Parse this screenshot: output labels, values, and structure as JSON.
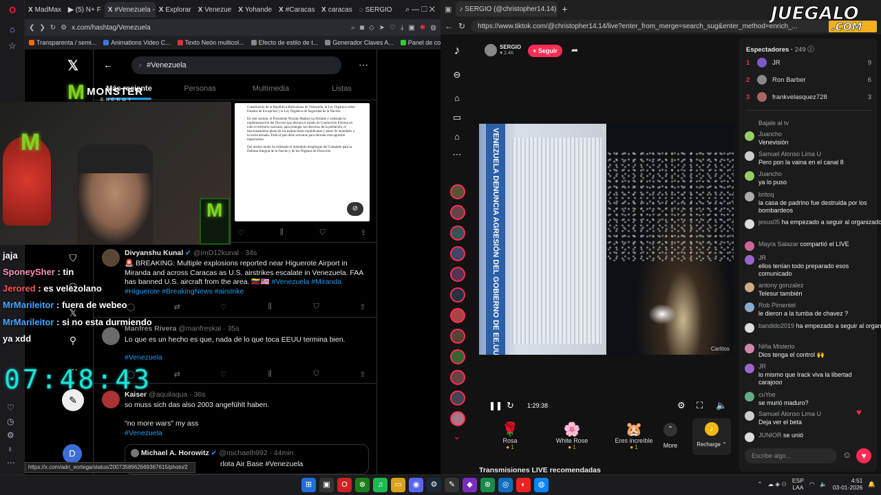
{
  "left_browser": {
    "tabs": [
      {
        "label": "MadMax",
        "fav": "X"
      },
      {
        "label": "(5) N+ F",
        "fav": "▶"
      },
      {
        "label": "#Venezuela - Bú",
        "fav": "X"
      },
      {
        "label": "Explorar",
        "fav": "X"
      },
      {
        "label": "Venezue",
        "fav": "X"
      },
      {
        "label": "Yohande",
        "fav": "X"
      },
      {
        "label": "#Caracas",
        "fav": "X"
      },
      {
        "label": "caracas",
        "fav": "X"
      },
      {
        "label": "SERGIO",
        "fav": "◌"
      }
    ],
    "url": "x.com/hashtag/Venezuela",
    "bookmarks": [
      {
        "label": "Transparenta / semi...",
        "color": "#ff6a00"
      },
      {
        "label": "Animations Video C...",
        "color": "#3a7bd5"
      },
      {
        "label": "Texto Neón multicol...",
        "color": "#d33"
      },
      {
        "label": "Efecto de estilo de t...",
        "color": "#888"
      },
      {
        "label": "Generador Claves A...",
        "color": "#888"
      },
      {
        "label": "Panel de control del...",
        "color": "#3c3"
      }
    ],
    "status_url": "https://x.com/adri_eortega/status/2007358962669367615/photo/2"
  },
  "x": {
    "search_value": "#Venezuela",
    "tabs": [
      "Más reciente",
      "Personas",
      "Multimedia",
      "Listas"
    ],
    "active_tab": "Más reciente",
    "avatar_letter": "D",
    "doc_paragraphs": [
      "Constitución de la República Bolivariana de Venezuela, la Ley Orgánica sobre Estados de Excepción y la Ley Orgánica de Seguridad de la Nación.",
      "En este sentido, el Presidente Nicolás Maduro ha firmado y ordenado la implementación del Decreto que declara el estado de Conmoción Externa en todo el territorio nacional, para proteger los derechos de la población, el funcionamiento pleno de las instituciones republicanas y pasar de inmediato a la lucha armada. Todo el país debe activarse para derrotar esta agresión imperialista.",
      "Del mismo modo ha ordenado el inmediato despliegue del Comando para la Defensa Integral de la Nación y de los Órganos de Dirección"
    ],
    "tweets": [
      {
        "name": "Divyanshu Kunal",
        "handle": "@imD12kunal",
        "time": "34s",
        "text_plain": "🚨 BREAKING: Multiple explosions reported near Higuerote Airport in Miranda and across Caracas as U.S. airstrikes escalate in Venezuela. FAA has banned U.S. aircraft from the area. 🇻🇪🇺🇸 ",
        "hashtags": "#Venezuela #Miranda #Higuerote #BreakingNews #airstrike"
      },
      {
        "name": "Manfres Rivera",
        "handle": "@manfreskal",
        "time": "35s",
        "text_plain": "Lo que es un hecho es que, nada de lo que toca EEUU termina bien.",
        "hashtags": "#Venezuela"
      },
      {
        "name": "Kaiser",
        "handle": "@aquilaqua",
        "time": "36s",
        "text_plain": "so muss sich das also 2003 angefühlt haben.",
        "text_2": "\"no more wars\" my ass",
        "hashtags": "#Venezuela"
      }
    ],
    "quoted": {
      "name": "Michael A. Horowitz",
      "handle": "@michaelh992",
      "time": "44min",
      "text": "rlota Air Base #Venezuela"
    }
  },
  "stream_overlay": {
    "brand": "MONSTER",
    "brand_sub": "ENERGY",
    "chat": [
      {
        "user": "",
        "text": "jaja",
        "color": "#ffffff"
      },
      {
        "user": "SponeySher",
        "text": " : tin",
        "color": "#ff8fb1"
      },
      {
        "user": "Jerored",
        "text": " : es velezolano",
        "color": "#ff5252"
      },
      {
        "user": "MrMarileitor",
        "text": " : fuera de webeo",
        "color": "#4aa3ff"
      },
      {
        "user": "MrMarileitor",
        "text": " : si no esta durmiendo",
        "color": "#4aa3ff"
      },
      {
        "user": "",
        "text": "ya xdd",
        "color": "#ffffff"
      }
    ],
    "clock": "07:48:43"
  },
  "right_browser": {
    "tab_label": "SERGIO (@christopher14.14)",
    "url": "https://www.tiktok.com/@christopher14.14/live?enter_from_merge=search_sug&enter_method=enrich_...",
    "brand": "JUEGALO",
    "brand_sub": ".COM",
    "streamer_name": "SERGIO",
    "streamer_likes": "2.4K",
    "follow_label": "+ Seguir",
    "video_caption": "Carlitos",
    "video_doc_banner": "VENEZUELA DENUNCIA AGRESIÓN DEL GOBIERNO DE EE.UU",
    "elapsed": "1:29:38",
    "gifts": [
      {
        "name": "Rosa",
        "cost": "1",
        "icon": "🌹"
      },
      {
        "name": "White Rose",
        "cost": "1",
        "icon": "🌸"
      },
      {
        "name": "Eres increíble",
        "cost": "1",
        "icon": "🐹"
      }
    ],
    "more_label": "More",
    "recharge_label": "Recharge",
    "recommended_label": "Transmisiones LIVE recomendadas",
    "viewers_label": "Espectadores",
    "viewers_count": "249",
    "top_viewers": [
      {
        "rank": "1",
        "name": "JR",
        "count": "9"
      },
      {
        "rank": "2",
        "name": "Ron Barber",
        "count": "6"
      },
      {
        "rank": "3",
        "name": "frankvelasquez728",
        "count": "3"
      }
    ],
    "comments": [
      {
        "user": "",
        "text": "Bajale al tv",
        "color": "#7aa"
      },
      {
        "user": "Juancho",
        "text": "Venevisión",
        "color": "#9c6"
      },
      {
        "user": "Samuel Alonso Lima U",
        "text": "Pero pon la vaina en el canal 8",
        "color": "#ccc"
      },
      {
        "user": "Juancho",
        "text": "ya lo puso",
        "color": "#9c6"
      },
      {
        "user": "britoq",
        "text": "la casa de padrino fue destruida por los bombardeos",
        "color": "#aaa"
      },
      {
        "user": "jesus05",
        "text": "ha empezado a seguir al organizador",
        "color": "#ddd"
      },
      {
        "user": "Mayra Salazar",
        "text": "compartió el LIVE",
        "color": "#c69"
      },
      {
        "user": "JR",
        "text": "ellos tenían todo preparado esos comunicado",
        "color": "#96c"
      },
      {
        "user": "antony gonzalez",
        "text": "Telesur también",
        "color": "#ca8"
      },
      {
        "user": "Rob Pimentel",
        "text": "le dieron a la tumba de chavez ?",
        "color": "#8ac"
      },
      {
        "user": "bandido2019",
        "text": "ha empezado a seguir al organizador",
        "color": "#ddd"
      },
      {
        "user": "Niña Misterio",
        "text": "Dios tenga el control 🙌",
        "color": "#c8a"
      },
      {
        "user": "JR",
        "text": "lo mismo que Irack viva la libertad carajooo",
        "color": "#96c"
      },
      {
        "user": "cuYoe",
        "text": "se murió maduro?",
        "color": "#6a8"
      },
      {
        "user": "Samuel Alonso Lima U",
        "text": "Deja ver el beta",
        "color": "#ccc"
      },
      {
        "user": "JUNIOR",
        "text": "se unió",
        "color": "#ddd"
      }
    ],
    "input_placeholder": "Escribe algo..."
  },
  "taskbar": {
    "lang": "ESP",
    "lang2": "LAA",
    "time": "4:51",
    "date": "03-01-2026"
  },
  "colors": {
    "x_blue": "#1d9bf0",
    "tiktok_red": "#fe2c55",
    "clock_cyan": "#22e3d6",
    "monster_green": "#7ed321"
  }
}
